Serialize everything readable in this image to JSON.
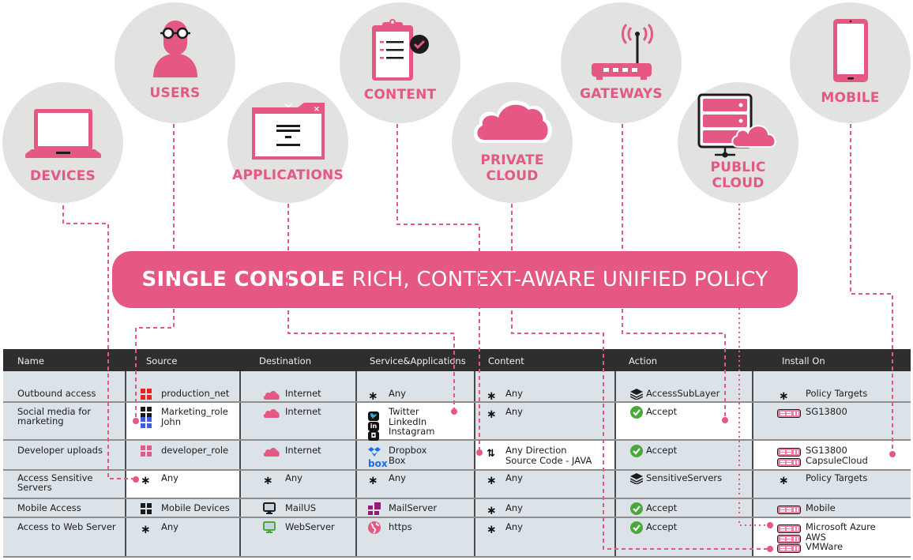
{
  "categories": [
    {
      "id": "devices",
      "label": "DEVICES",
      "icon": "laptop-icon"
    },
    {
      "id": "users",
      "label": "USERS",
      "icon": "user-icon"
    },
    {
      "id": "applications",
      "label": "APPLICATIONS",
      "icon": "app-window-icon"
    },
    {
      "id": "content",
      "label": "CONTENT",
      "icon": "clipboard-check-icon"
    },
    {
      "id": "private_cloud",
      "label_line1": "PRIVATE",
      "label_line2": "CLOUD",
      "icon": "cloud-icon"
    },
    {
      "id": "gateways",
      "label": "GATEWAYS",
      "icon": "router-icon"
    },
    {
      "id": "public_cloud",
      "label_line1": "PUBLIC",
      "label_line2": "CLOUD",
      "icon": "server-cloud-icon"
    },
    {
      "id": "mobile",
      "label": "MOBILE",
      "icon": "smartphone-icon"
    }
  ],
  "banner": {
    "bold": "SINGLE CONSOLE",
    "rest": "RICH, CONTEXT-AWARE UNIFIED POLICY"
  },
  "colors": {
    "accent": "#e45883",
    "circle_bg": "#e2e2e0",
    "header_bg": "#2e2e2e",
    "row_bg": "#dbe2e8",
    "accept_green": "#4aa83a"
  },
  "table": {
    "headers": [
      "Name",
      "Source",
      "Destination",
      "Service&Applications",
      "Content",
      "Action",
      "Install On"
    ],
    "rows": [
      {
        "name": "Outbound access",
        "source": [
          {
            "icon": "network-red-icon",
            "text": "production_net"
          }
        ],
        "destination": [
          {
            "icon": "cloud-icon",
            "text": "Internet"
          }
        ],
        "service": [
          {
            "icon": "any-icon",
            "text": "Any"
          }
        ],
        "content": [
          {
            "icon": "any-icon",
            "text": "Any"
          }
        ],
        "action": [
          {
            "icon": "layers-icon",
            "text": "AccessSubLayer"
          }
        ],
        "install": [
          {
            "icon": "any-icon",
            "text": "Policy Targets"
          }
        ]
      },
      {
        "name": "Social media for marketing",
        "source": [
          {
            "icon": "role-black-icon",
            "text": "Marketing_role"
          },
          {
            "icon": "user-blue-icon",
            "text": "John"
          }
        ],
        "destination": [
          {
            "icon": "cloud-icon",
            "text": "Internet"
          }
        ],
        "service": [
          {
            "icon": "twitter-icon",
            "text": "Twitter"
          },
          {
            "icon": "linkedin-icon",
            "text": "LinkedIn"
          },
          {
            "icon": "instagram-icon",
            "text": "Instagram"
          }
        ],
        "content": [
          {
            "icon": "any-icon",
            "text": "Any"
          }
        ],
        "action": [
          {
            "icon": "accept-icon",
            "text": "Accept"
          }
        ],
        "install": [
          {
            "icon": "gateway-icon",
            "text": "SG13800"
          }
        ]
      },
      {
        "name": "Developer uploads",
        "source": [
          {
            "icon": "role-pink-icon",
            "text": "developer_role"
          }
        ],
        "destination": [
          {
            "icon": "cloud-icon",
            "text": "Internet"
          }
        ],
        "service": [
          {
            "icon": "dropbox-icon",
            "text": "Dropbox"
          },
          {
            "icon": "box-icon",
            "text": "Box"
          }
        ],
        "content": [
          {
            "icon": "direction-icon",
            "text": "Any Direction"
          },
          {
            "icon": "",
            "text": "Source Code - JAVA"
          }
        ],
        "action": [
          {
            "icon": "accept-icon",
            "text": "Accept"
          }
        ],
        "install": [
          {
            "icon": "gateway-icon",
            "text": "SG13800"
          },
          {
            "icon": "gateway-icon",
            "text": "CapsuleCloud"
          }
        ]
      },
      {
        "name": "Access Sensitive Servers",
        "source": [
          {
            "icon": "any-icon",
            "text": "Any"
          }
        ],
        "destination": [
          {
            "icon": "any-icon",
            "text": "Any"
          }
        ],
        "service": [
          {
            "icon": "any-icon",
            "text": "Any"
          }
        ],
        "content": [
          {
            "icon": "any-icon",
            "text": "Any"
          }
        ],
        "action": [
          {
            "icon": "layers-icon",
            "text": "SensitiveServers"
          }
        ],
        "install": [
          {
            "icon": "any-icon",
            "text": "Policy Targets"
          }
        ]
      },
      {
        "name": "Mobile Access",
        "source": [
          {
            "icon": "role-black-icon",
            "text": "Mobile Devices"
          }
        ],
        "destination": [
          {
            "icon": "monitor-icon",
            "text": "MailUS"
          }
        ],
        "service": [
          {
            "icon": "mailserver-icon",
            "text": "MailServer"
          }
        ],
        "content": [
          {
            "icon": "any-icon",
            "text": "Any"
          }
        ],
        "action": [
          {
            "icon": "accept-icon",
            "text": "Accept"
          }
        ],
        "install": [
          {
            "icon": "gateway-icon",
            "text": "Mobile"
          }
        ]
      },
      {
        "name": "Access to Web Server",
        "source": [
          {
            "icon": "any-icon",
            "text": "Any"
          }
        ],
        "destination": [
          {
            "icon": "monitor-green-icon",
            "text": "WebServer"
          }
        ],
        "service": [
          {
            "icon": "globe-icon",
            "text": "https"
          }
        ],
        "content": [
          {
            "icon": "any-icon",
            "text": "Any"
          }
        ],
        "action": [
          {
            "icon": "accept-icon",
            "text": "Accept"
          }
        ],
        "install": [
          {
            "icon": "gateway-icon",
            "text": "Microsoft Azure"
          },
          {
            "icon": "gateway-icon",
            "text": "AWS"
          },
          {
            "icon": "gateway-icon",
            "text": "VMWare"
          }
        ]
      }
    ]
  }
}
